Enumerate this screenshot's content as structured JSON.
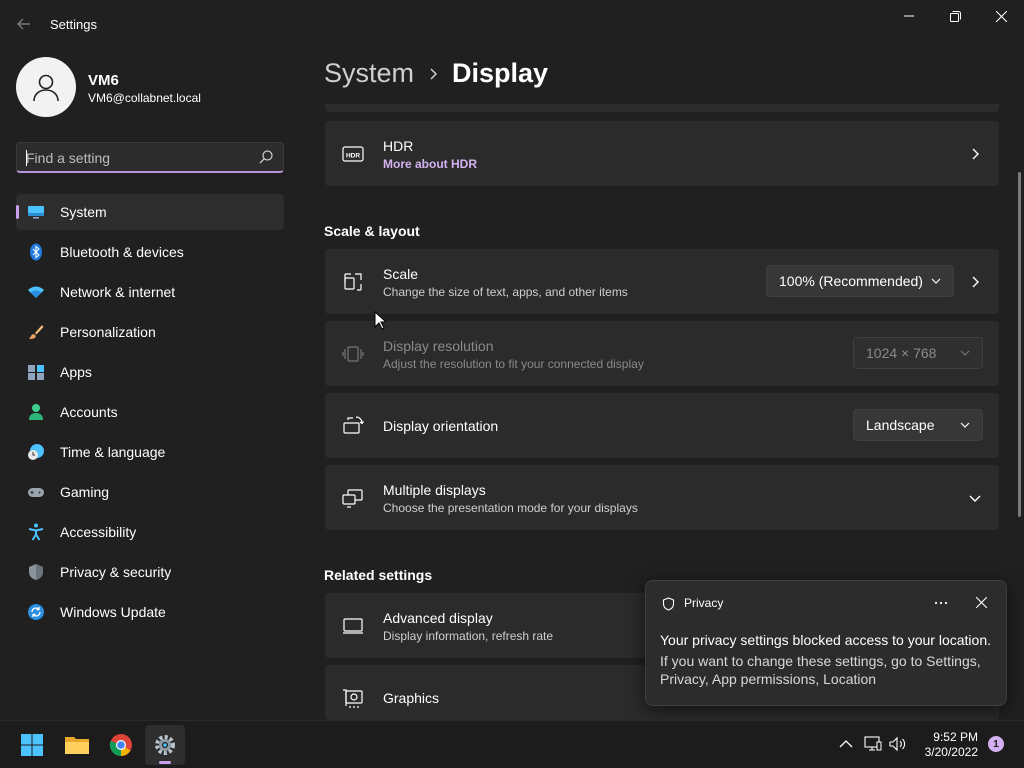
{
  "window": {
    "title": "Settings"
  },
  "user": {
    "name": "VM6",
    "email": "VM6@collabnet.local"
  },
  "search": {
    "placeholder": "Find a setting",
    "value": ""
  },
  "sidebar": {
    "items": [
      {
        "label": "System",
        "icon": "system-icon",
        "active": true
      },
      {
        "label": "Bluetooth & devices",
        "icon": "bluetooth-icon"
      },
      {
        "label": "Network & internet",
        "icon": "wifi-icon"
      },
      {
        "label": "Personalization",
        "icon": "brush-icon"
      },
      {
        "label": "Apps",
        "icon": "apps-icon"
      },
      {
        "label": "Accounts",
        "icon": "account-icon"
      },
      {
        "label": "Time & language",
        "icon": "clock-globe-icon"
      },
      {
        "label": "Gaming",
        "icon": "gamepad-icon"
      },
      {
        "label": "Accessibility",
        "icon": "accessibility-icon"
      },
      {
        "label": "Privacy & security",
        "icon": "shield-icon"
      },
      {
        "label": "Windows Update",
        "icon": "update-icon"
      }
    ]
  },
  "breadcrumb": {
    "parent": "System",
    "separator": "›",
    "current": "Display"
  },
  "hdr": {
    "title": "HDR",
    "link": "More about HDR"
  },
  "scale_layout": {
    "heading": "Scale & layout",
    "scale": {
      "title": "Scale",
      "description": "Change the size of text, apps, and other items",
      "value": "100% (Recommended)"
    },
    "resolution": {
      "title": "Display resolution",
      "description": "Adjust the resolution to fit your connected display",
      "value": "1024 × 768"
    },
    "orientation": {
      "title": "Display orientation",
      "value": "Landscape"
    },
    "multiple": {
      "title": "Multiple displays",
      "description": "Choose the presentation mode for your displays"
    }
  },
  "related": {
    "heading": "Related settings",
    "advanced": {
      "title": "Advanced display",
      "description": "Display information, refresh rate"
    },
    "graphics": {
      "title": "Graphics"
    }
  },
  "toast": {
    "app": "Privacy",
    "title": "Your privacy settings blocked access to your location.",
    "body": "If you want to change these settings, go to Settings, Privacy, App permissions, Location"
  },
  "taskbar": {
    "time": "9:52 PM",
    "date": "3/20/2022",
    "notification_count": "1"
  },
  "colors": {
    "accent": "#c89de9",
    "background": "#202020",
    "card": "#2b2b2b"
  }
}
